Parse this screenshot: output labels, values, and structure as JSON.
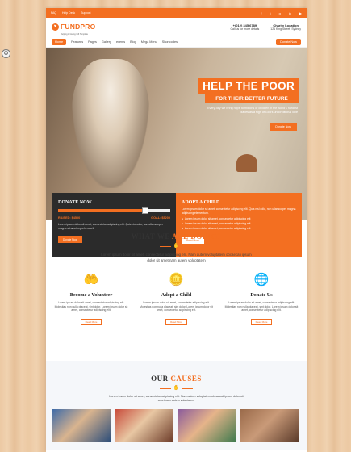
{
  "colors": {
    "accent": "#f36f21",
    "dark": "#2b2b2b",
    "light_bg": "#f5f7fa"
  },
  "topbar": {
    "links": [
      "FAQ",
      "Help Desk",
      "Support"
    ],
    "social_icons": [
      "facebook-icon",
      "twitter-icon",
      "google-plus-icon",
      "linkedin-icon",
      "youtube-icon"
    ]
  },
  "header": {
    "logo_name": "FUNDPRO",
    "logo_tagline": "Helping & Giving Gift Template",
    "phone": "+(012) 345 6789",
    "phone_sub": "Call us for more details",
    "location": "Charity Location",
    "location_sub": "121 King Street, Sydney"
  },
  "nav": {
    "items": [
      "Home",
      "Features",
      "Pages",
      "Gallery",
      "events",
      "Blog",
      "Mega Menu",
      "Shortcodes"
    ],
    "donate_label": "Donate Now"
  },
  "hero": {
    "title": "HELP THE POOR",
    "subtitle": "FOR THEIR BETTER FUTURE",
    "text": "Every day we bring hope to millions of children in the world's hardest places as a sign of God's unconditional love",
    "button": "Donate Now"
  },
  "donate_box": {
    "title": "DONATE NOW",
    "progress_percent": 78,
    "raised": "RAISED: $4500",
    "goal": "GOAL: $5200",
    "text": "Lorem ipsum dolor sit amet, consectetur adipiscing elit. Quis nisl odio, non ullamcorper magna sit amet reprehenderit.",
    "button": "Donate Now"
  },
  "adopt_box": {
    "title": "ADOPT A CHILD",
    "text": "Lorem ipsum dolor sit amet, consectetur adipiscing elit. Quis nisl odio, non ullamcorper magna adipiscing elementum.",
    "bullets": [
      "Lorem ipsum dolor sit amet, consectetur adipiscing elit",
      "Lorem ipsum dolor sit amet, consectetur adipiscing elit",
      "Lorem ipsum dolor sit amet, consectetur adipiscing elit"
    ],
    "button": "Read More"
  },
  "doing": {
    "title_a": "WHAT WE ",
    "title_b": "ARE DOING?",
    "lead": "Lorem ipsum dolor sit amet, consectetur adipiscing elit. Nam autem voluptatem obcaecati ipsum dolor sit amet nam autem voluptatem",
    "cards": [
      {
        "icon": "hands-heart-icon",
        "glyph": "♥",
        "title": "Become a Volunteer",
        "text": "Lorem ipsum dolor sit amet, consectetur adipiscing elit. Molestias non nulla placeat, sint dolor. Lorem ipsum dolor sit amet, consectetur adipiscing elit.",
        "button": "Read More"
      },
      {
        "icon": "coin-hand-icon",
        "glyph": "$",
        "title": "Adopt a Child",
        "text": "Lorem ipsum dolor sit amet, consectetur adipiscing elit. Molestias non nulla placeat, sint dolor. Lorem ipsum dolor sit amet, consectetur adipiscing elit.",
        "button": "Read More"
      },
      {
        "icon": "globe-icon",
        "glyph": "◍",
        "title": "Donate Us",
        "text": "Lorem ipsum dolor sit amet, consectetur adipiscing elit. Molestias non nulla placeat, sint dolor. Lorem ipsum dolor sit amet, consectetur adipiscing elit.",
        "button": "Read More"
      }
    ]
  },
  "causes": {
    "title_a": "OUR ",
    "title_b": "CAUSES",
    "lead": "Lorem ipsum dolor sit amet, consectetur adipiscing elit. Nam autem voluptatem obcaecati ipsum dolor sit amet nam autem voluptatem"
  }
}
